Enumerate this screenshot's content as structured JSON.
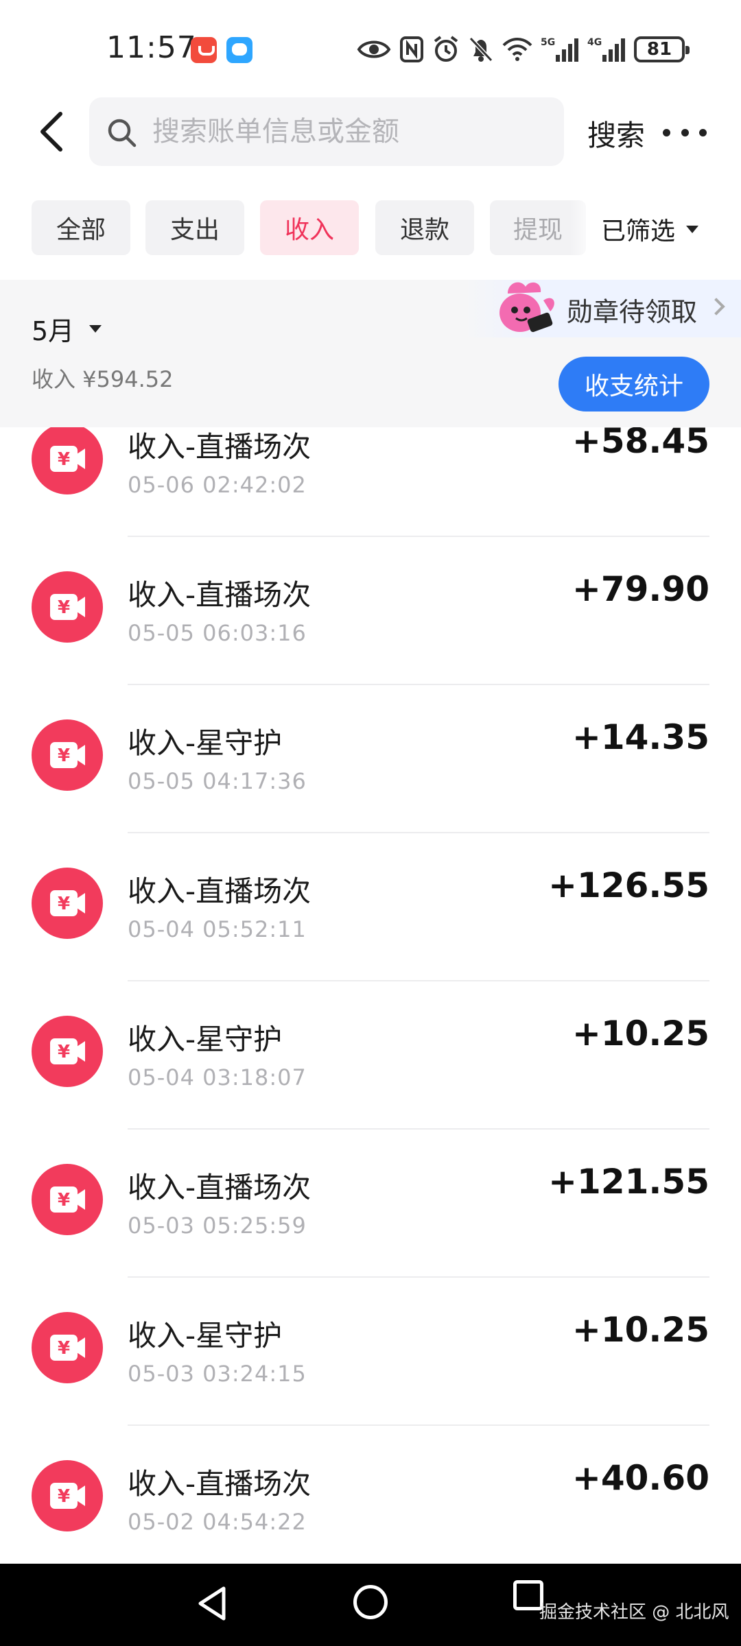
{
  "status_bar": {
    "time": "11:57",
    "battery": "81",
    "network_a": "5G",
    "network_b": "4G"
  },
  "header": {
    "search_placeholder": "搜索账单信息或金额",
    "search_button": "搜索"
  },
  "filters": {
    "chips": [
      "全部",
      "支出",
      "收入",
      "退款",
      "提现"
    ],
    "active_index": 2,
    "filtered_label": "已筛选"
  },
  "summary": {
    "month": "5月",
    "income_total": "收入 ¥594.52",
    "badge_text": "勋章待领取",
    "stats_button": "收支统计"
  },
  "transactions": [
    {
      "title": "收入-直播场次",
      "time": "05-06 02:42:02",
      "amount": "+58.45"
    },
    {
      "title": "收入-直播场次",
      "time": "05-05 06:03:16",
      "amount": "+79.90"
    },
    {
      "title": "收入-星守护",
      "time": "05-05 04:17:36",
      "amount": "+14.35"
    },
    {
      "title": "收入-直播场次",
      "time": "05-04 05:52:11",
      "amount": "+126.55"
    },
    {
      "title": "收入-星守护",
      "time": "05-04 03:18:07",
      "amount": "+10.25"
    },
    {
      "title": "收入-直播场次",
      "time": "05-03 05:25:59",
      "amount": "+121.55"
    },
    {
      "title": "收入-星守护",
      "time": "05-03 03:24:15",
      "amount": "+10.25"
    },
    {
      "title": "收入-直播场次",
      "time": "05-02 04:54:22",
      "amount": "+40.60"
    }
  ],
  "watermark": "掘金技术社区 @ 北北风",
  "colors": {
    "accent_red": "#f23b5c",
    "active_chip_bg": "#fde7ec",
    "primary_blue": "#2e7cf6"
  }
}
